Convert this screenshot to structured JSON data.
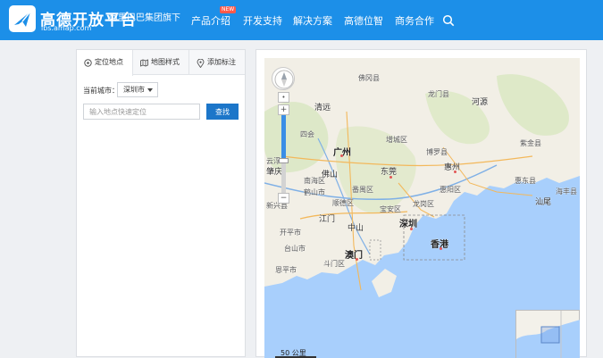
{
  "header": {
    "logo_title": "高德开放平台",
    "logo_url": "lbs.amap.com",
    "group": "阿里巴巴集团旗下",
    "nav": [
      {
        "label": "产品介绍",
        "badge": "NEW"
      },
      {
        "label": "开发支持"
      },
      {
        "label": "解决方案"
      },
      {
        "label": "高德位智"
      },
      {
        "label": "商务合作"
      }
    ],
    "search_icon": "search-icon"
  },
  "panel": {
    "tabs": [
      {
        "label": "定位地点",
        "icon": "target-icon",
        "active": true
      },
      {
        "label": "地图样式",
        "icon": "map-icon",
        "active": false
      },
      {
        "label": "添加标注",
        "icon": "pin-icon",
        "active": false
      }
    ],
    "city_label": "当前城市：",
    "city_value": "深圳市",
    "search_placeholder": "输入地点快速定位",
    "search_button": "查找"
  },
  "map": {
    "zoom_level_fraction": 0.42,
    "scale_label": "50 公里",
    "places": {
      "fogang": "佛冈县",
      "longmen": "龙门县",
      "qingyuan": "清远",
      "heyuan": "河源",
      "sihui": "四会",
      "guangzhou": "广州",
      "zengcheng": "增城区",
      "zhaoqing": "肇庆",
      "foshan": "佛山",
      "dongguan": "东莞",
      "huizhou": "惠州",
      "huidong": "惠东县",
      "heshan": "鹤山市",
      "jiangmen": "江门",
      "zhongshan": "中山",
      "shenzhen": "深圳",
      "hongkong": "香港",
      "macau": "澳门",
      "kaiping": "开平市",
      "taishan": "台山市",
      "shanwei": "汕尾",
      "xinxing": "新兴县",
      "huiyang": "惠阳区",
      "nanhai": "南海区",
      "shunde": "顺德区",
      "panyu": "番禺区",
      "baoan": "宝安区",
      "longgang": "龙岗区",
      "doumen": "斗门区",
      "haifeng": "海丰县",
      "enping": "恩平市",
      "zijin": "紫金县",
      "boluo": "博罗县",
      "yunfu": "云浮市"
    }
  }
}
